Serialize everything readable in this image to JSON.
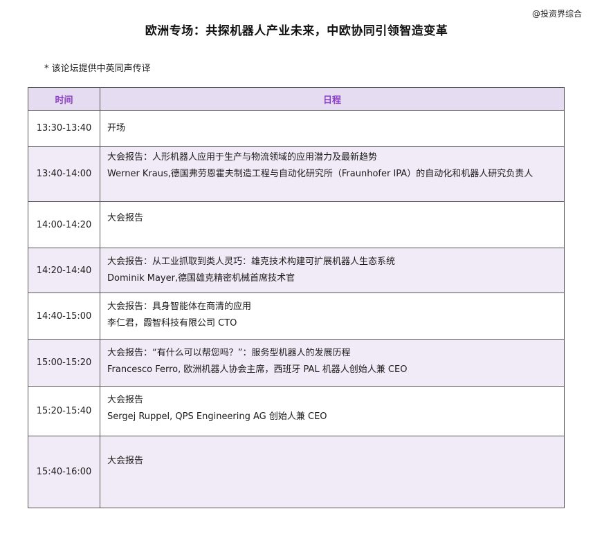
{
  "watermark": "@投资界综合",
  "title": "欧洲专场：共探机器人产业未来，中欧协同引领智造变革",
  "note": "*  该论坛提供中英同声传译",
  "table": {
    "headers": {
      "time": "时间",
      "schedule": "日程"
    },
    "rows": [
      {
        "time": "13:30-13:40",
        "title": "开场",
        "speaker": ""
      },
      {
        "time": "13:40-14:00",
        "title": "大会报告：人形机器人应用于生产与物流领域的应用潜力及最新趋势",
        "speaker": "Werner Kraus,德国弗劳恩霍夫制造工程与自动化研究所（Fraunhofer IPA）的自动化和机器人研究负责人"
      },
      {
        "time": "14:00-14:20",
        "title": "大会报告",
        "speaker": ""
      },
      {
        "time": "14:20-14:40",
        "title": "大会报告：从工业抓取到类人灵巧：雄克技术构建可扩展机器人生态系统",
        "speaker": "Dominik Mayer,德国雄克精密机械首席技术官"
      },
      {
        "time": "14:40-15:00",
        "title": "大会报告：具身智能体在商清的应用",
        "speaker": "李仁君，霞智科技有限公司 CTO"
      },
      {
        "time": "15:00-15:20",
        "title": "大会报告：“有什么可以帮您吗？”：服务型机器人的发展历程",
        "speaker": "Francesco Ferro, 欧洲机器人协会主席，西班牙 PAL 机器人创始人兼 CEO"
      },
      {
        "time": "15:20-15:40",
        "title": "大会报告",
        "speaker": "Sergej Ruppel, QPS Engineering AG 创始人兼 CEO"
      },
      {
        "time": "15:40-16:00",
        "title": "大会报告",
        "speaker": ""
      }
    ]
  }
}
